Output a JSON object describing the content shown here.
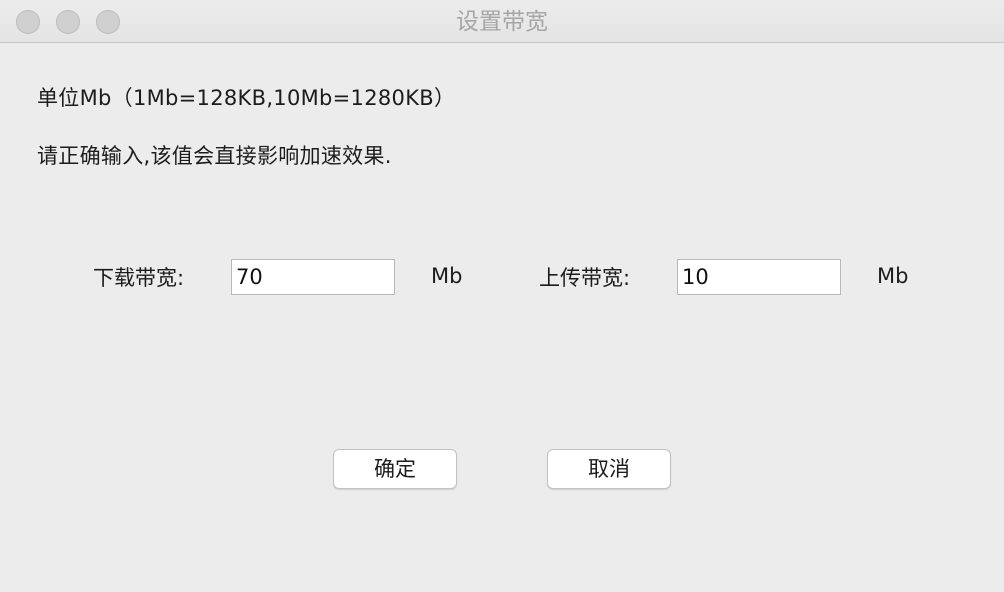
{
  "window": {
    "title": "设置带宽",
    "traffic_lights": [
      "close",
      "minimize",
      "zoom"
    ]
  },
  "info": {
    "line1": "单位Mb（1Mb=128KB,10Mb=1280KB）",
    "line2": "请正确输入,该值会直接影响加速效果."
  },
  "download": {
    "label": "下载带宽:",
    "value": "70",
    "unit": "Mb"
  },
  "upload": {
    "label": "上传带宽:",
    "value": "10",
    "unit": "Mb"
  },
  "buttons": {
    "confirm": "确定",
    "cancel": "取消"
  },
  "colors": {
    "background": "#ececec",
    "title_text": "#a6a6a6",
    "traffic_light_inactive": "#d0d0d0"
  }
}
